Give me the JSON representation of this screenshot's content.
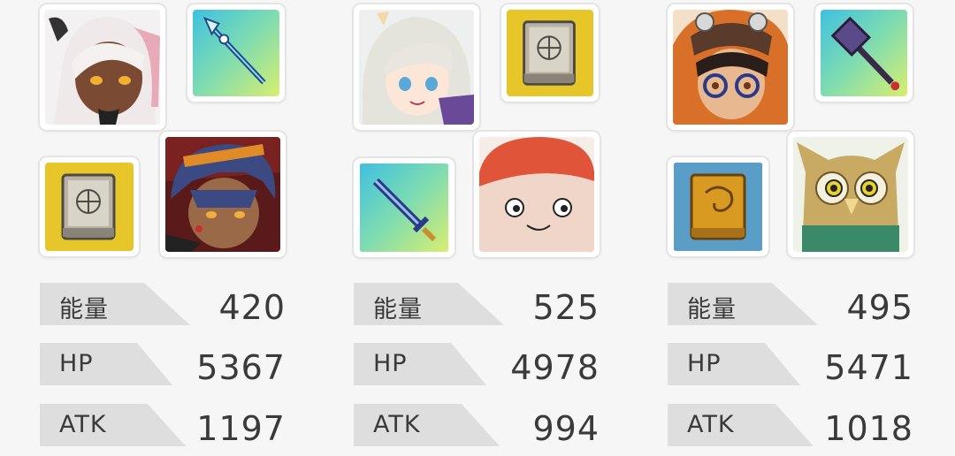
{
  "teams": [
    {
      "main_character": "white-haired-girl-portrait",
      "top_item": "spear-icon",
      "bottom_item": "tome-icon",
      "partner_character": "blue-haired-warrior-portrait",
      "stats": [
        {
          "label": "能量",
          "value": "420"
        },
        {
          "label": "HP",
          "value": "5367"
        },
        {
          "label": "ATK",
          "value": "1197"
        }
      ]
    },
    {
      "main_character": "silver-haired-mage-portrait",
      "top_item": "tome-icon",
      "bottom_item": "sword-icon",
      "partner_character": "mushroom-creature-portrait",
      "stats": [
        {
          "label": "能量",
          "value": "525"
        },
        {
          "label": "HP",
          "value": "4978"
        },
        {
          "label": "ATK",
          "value": "994"
        }
      ]
    },
    {
      "main_character": "goggles-boy-portrait",
      "top_item": "hammer-icon",
      "bottom_item": "golden-book-icon",
      "partner_character": "owl-portrait",
      "stats": [
        {
          "label": "能量",
          "value": "495"
        },
        {
          "label": "HP",
          "value": "5471"
        },
        {
          "label": "ATK",
          "value": "1018"
        }
      ]
    }
  ]
}
